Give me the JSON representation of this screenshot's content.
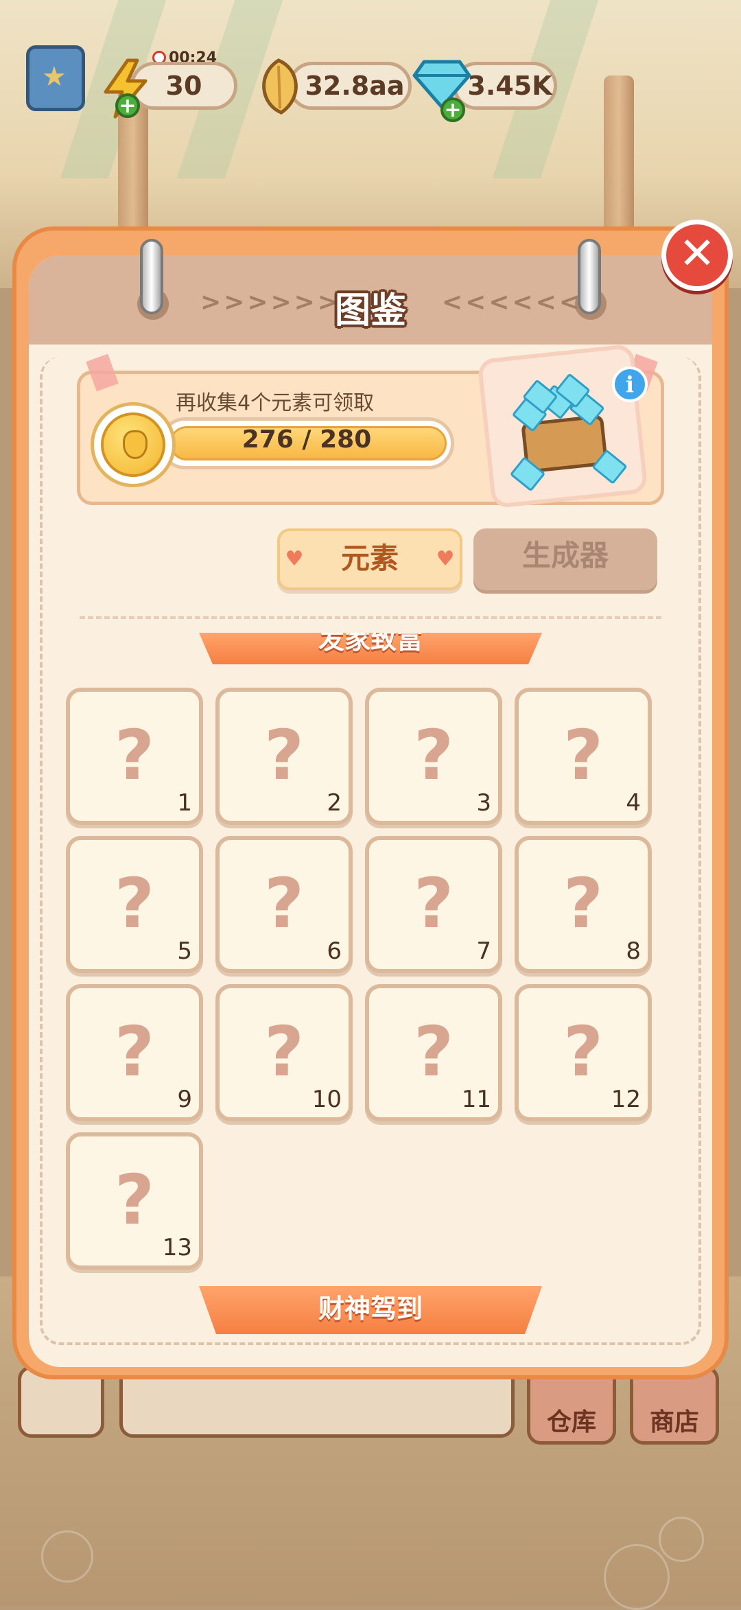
{
  "hud": {
    "energy_timer": "00:24",
    "energy_value": "30",
    "seed_value": "32.8aa",
    "gem_value": "3.45K"
  },
  "panel": {
    "title": "图鉴",
    "chevrons_left": ">>>>>>",
    "chevrons_right": "<<<<<<",
    "close_label": "✕"
  },
  "reward": {
    "text": "再收集4个元素可领取",
    "progress_text": "276 / 280",
    "progress_current": 276,
    "progress_total": 280,
    "info_label": "i"
  },
  "tabs": [
    {
      "label": "元素",
      "active": true
    },
    {
      "label": "生成器",
      "active": false
    }
  ],
  "sections": {
    "top_ribbon": "发家致富",
    "bottom_ribbon": "财神驾到"
  },
  "grid": {
    "items": [
      {
        "symbol": "?",
        "num": "1"
      },
      {
        "symbol": "?",
        "num": "2"
      },
      {
        "symbol": "?",
        "num": "3"
      },
      {
        "symbol": "?",
        "num": "4"
      },
      {
        "symbol": "?",
        "num": "5"
      },
      {
        "symbol": "?",
        "num": "6"
      },
      {
        "symbol": "?",
        "num": "7"
      },
      {
        "symbol": "?",
        "num": "8"
      },
      {
        "symbol": "?",
        "num": "9"
      },
      {
        "symbol": "?",
        "num": "10"
      },
      {
        "symbol": "?",
        "num": "11"
      },
      {
        "symbol": "?",
        "num": "12"
      },
      {
        "symbol": "?",
        "num": "13"
      }
    ]
  },
  "bottom_bar": {
    "warehouse_label": "仓库",
    "shop_label": "商店"
  },
  "colors": {
    "panel_orange": "#f6a86a",
    "ribbon_orange": "#f57f42",
    "close_red": "#e64a3c",
    "tab_active_text": "#b0571f"
  },
  "icons": {
    "book": "star-book-icon",
    "energy": "lightning-icon",
    "seed": "seed-icon",
    "gem": "diamond-icon",
    "close": "close-icon",
    "coin": "acorn-coin-icon",
    "chest": "gem-chest-icon",
    "info": "info-icon"
  }
}
